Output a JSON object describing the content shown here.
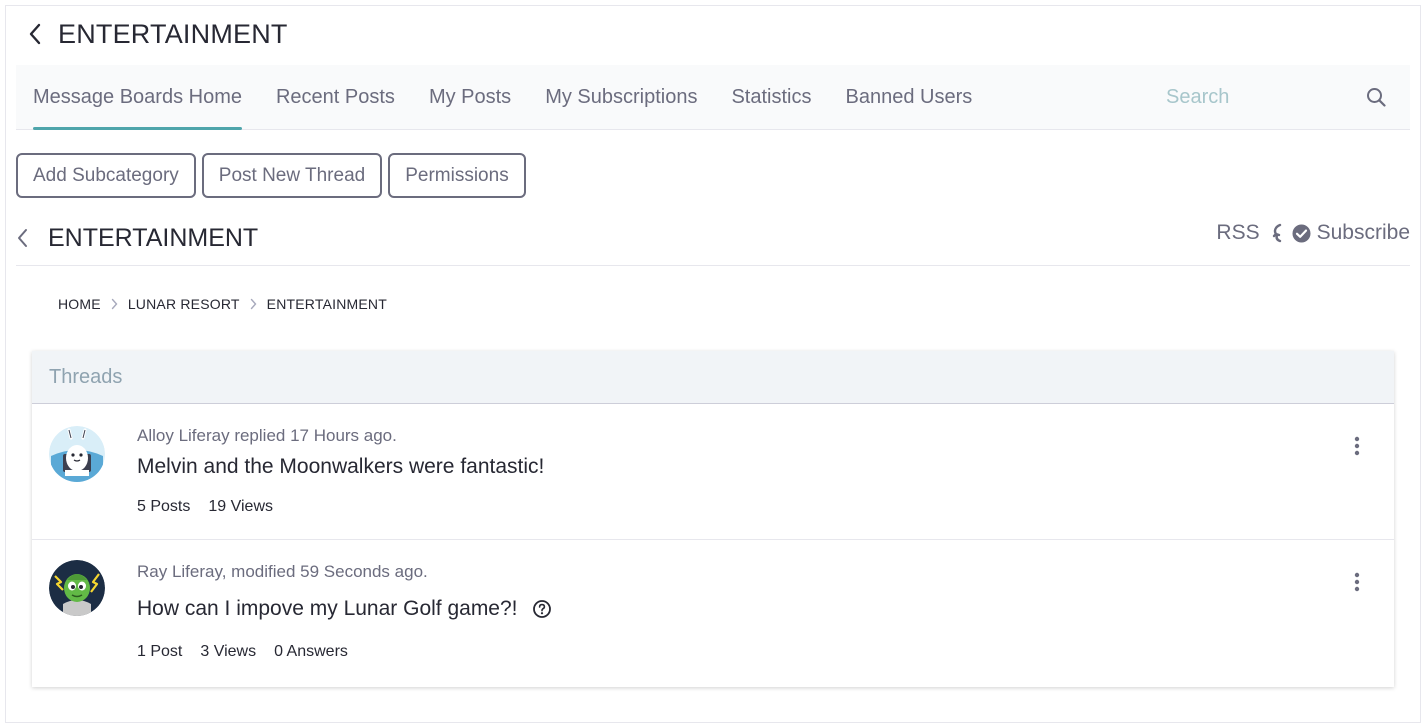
{
  "header": {
    "title": "ENTERTAINMENT"
  },
  "nav": {
    "tabs": [
      {
        "label": "Message Boards Home",
        "active": true
      },
      {
        "label": "Recent Posts",
        "active": false
      },
      {
        "label": "My Posts",
        "active": false
      },
      {
        "label": "My Subscriptions",
        "active": false
      },
      {
        "label": "Statistics",
        "active": false
      },
      {
        "label": "Banned Users",
        "active": false
      }
    ],
    "search": {
      "placeholder": "Search",
      "value": ""
    }
  },
  "actions": {
    "add_subcategory": "Add Subcategory",
    "post_new_thread": "Post New Thread",
    "permissions": "Permissions"
  },
  "category": {
    "title": "ENTERTAINMENT",
    "rss_label": "RSS",
    "subscribe_label": "Subscribe"
  },
  "breadcrumb": [
    "HOME",
    "LUNAR RESORT",
    "ENTERTAINMENT"
  ],
  "threads_panel": {
    "header": "Threads",
    "threads": [
      {
        "meta": "Alloy Liferay replied 17 Hours ago.",
        "title": "Melvin and the Moonwalkers were fantastic!",
        "stats": [
          "5 Posts",
          "19 Views"
        ],
        "question": false
      },
      {
        "meta": "Ray Liferay, modified 59 Seconds ago.",
        "title": "How can I impove my Lunar Golf game?!",
        "stats": [
          "1 Post",
          "3 Views",
          "0 Answers"
        ],
        "question": true
      }
    ]
  },
  "colors": {
    "accent": "#4fa5ab",
    "text_primary": "#272833",
    "text_secondary": "#6b6c7e",
    "panel_header_bg": "#f1f4f7"
  },
  "icons": {
    "back": "chevron-left-icon",
    "search": "search-icon",
    "rss": "rss-icon",
    "subscribe": "check-circle-icon",
    "breadcrumb_sep": "chevron-right-icon",
    "question": "question-circle-icon",
    "menu": "kebab-icon"
  }
}
